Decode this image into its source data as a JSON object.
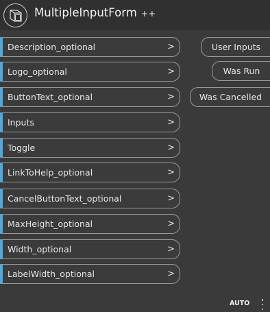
{
  "node": {
    "title": "MultipleInputForm",
    "title_suffix": "++",
    "icon": "custom-node-icon"
  },
  "inputs": [
    {
      "label": "Description_optional",
      "arrow": ">"
    },
    {
      "label": "Logo_optional",
      "arrow": ">"
    },
    {
      "label": "ButtonText_optional",
      "arrow": ">"
    },
    {
      "label": "Inputs",
      "arrow": ">"
    },
    {
      "label": "Toggle",
      "arrow": ">"
    },
    {
      "label": "LinkToHelp_optional",
      "arrow": ">"
    },
    {
      "label": "CancelButtonText_optional",
      "arrow": ">"
    },
    {
      "label": "MaxHeight_optional",
      "arrow": ">"
    },
    {
      "label": "Width_optional",
      "arrow": ">"
    },
    {
      "label": "LabelWidth_optional",
      "arrow": ">"
    }
  ],
  "outputs": [
    {
      "label": "User Inputs"
    },
    {
      "label": "Was Run"
    },
    {
      "label": "Was Cancelled"
    }
  ],
  "footer": {
    "lacing": "AUTO",
    "menu_icon": "vertical-ellipsis-icon"
  },
  "colors": {
    "port_accent": "#5aa6d2",
    "background": "#3a3a3a",
    "header": "#303030"
  }
}
